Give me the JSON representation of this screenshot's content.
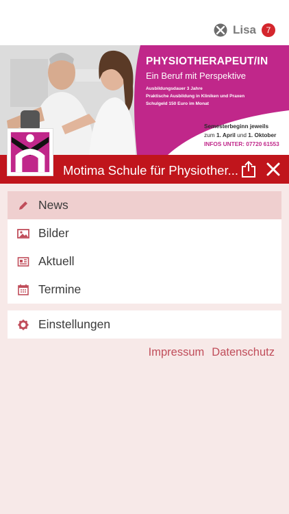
{
  "header": {
    "user_name": "Lisa",
    "notification_count": "7"
  },
  "banner": {
    "title": "PHYSIOTHERAPEUT/IN",
    "subtitle": "Ein Beruf mit Perspektive",
    "details": [
      "Ausbildungsdauer 3 Jahre",
      "Praktische Ausbildung in Kliniken und Praxen",
      "Schulgeld 150 Euro im Monat"
    ],
    "semester_line": "Semesterbeginn jeweils",
    "dates_prefix": "zum",
    "date_1": "1. April",
    "dates_joiner": "und",
    "date_2": "1. Oktober",
    "info_line": "INFOS UNTER: 07720 61553"
  },
  "titlebar": {
    "title": "Motima Schule für Physiother..."
  },
  "menu": {
    "items": [
      {
        "label": "News",
        "icon": "pencil-icon"
      },
      {
        "label": "Bilder",
        "icon": "image-icon"
      },
      {
        "label": "Aktuell",
        "icon": "newspaper-icon"
      },
      {
        "label": "Termine",
        "icon": "calendar-icon"
      }
    ],
    "settings": {
      "label": "Einstellungen",
      "icon": "gear-icon"
    }
  },
  "footer": {
    "impressum": "Impressum",
    "datenschutz": "Datenschutz"
  },
  "colors": {
    "accent": "#c0151c",
    "magenta": "#c0278a",
    "icon": "#c04d5a",
    "background": "#f7e9e8",
    "active_item": "#efcfcf"
  }
}
